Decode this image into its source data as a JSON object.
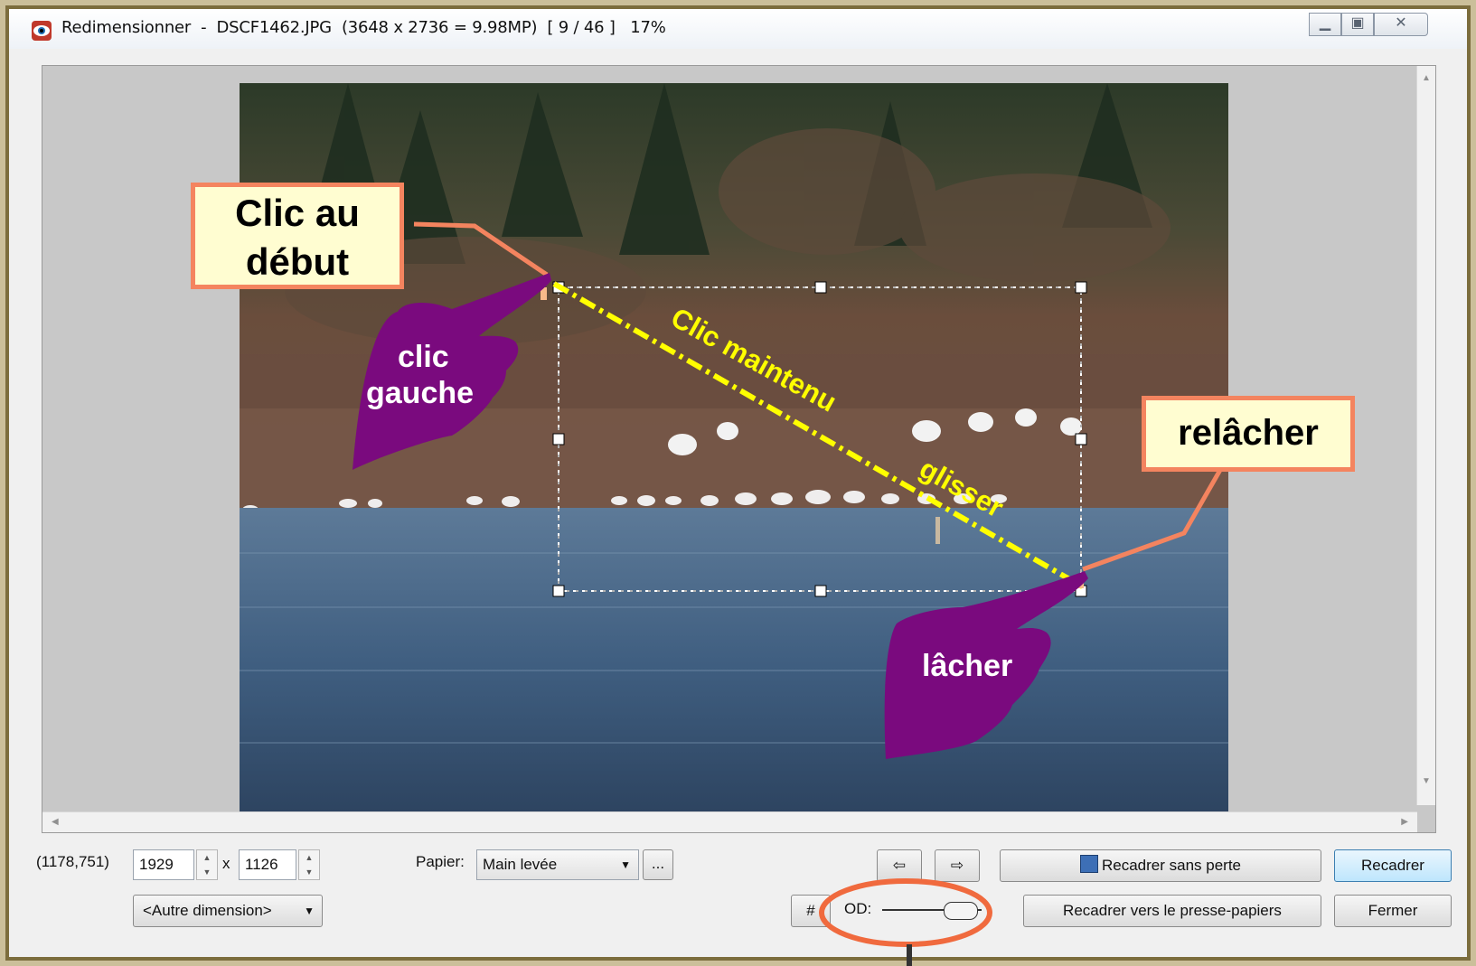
{
  "window": {
    "title": "Redimensionner  -  DSCF1462.JPG  (3648 x 2736 = 9.98MP)  [ 9 / 46 ]   17%",
    "controls": [
      "minimize-icon",
      "maximize-icon",
      "close-icon"
    ]
  },
  "annotations": {
    "start_callout": "Clic au début",
    "start_line1": "Clic au",
    "start_line2": "début",
    "left_hand_line1": "clic",
    "left_hand_line2": "gauche",
    "drag_text1": "Clic maintenu",
    "drag_text2": "glisser",
    "release_callout": "relâcher",
    "right_hand": "lâcher",
    "colors": {
      "callout_border": "#f4845f",
      "callout_fill": "#fffdd1",
      "hand": "#7a0a7e",
      "drag_line": "#ffff00",
      "od_circle": "#f06a3e"
    }
  },
  "status": {
    "cursor_pos": "(1178,751)"
  },
  "size": {
    "width": "1929",
    "times": "x",
    "height": "1126",
    "preset": "<Autre dimension>"
  },
  "paper": {
    "label": "Papier:",
    "value": "Main levée",
    "more": "..."
  },
  "nav": {
    "prev_icon": "arrow-left-icon",
    "next_icon": "arrow-right-icon"
  },
  "grid": {
    "label": "#"
  },
  "od": {
    "label": "OD:"
  },
  "buttons": {
    "lossless": "Recadrer sans perte",
    "crop": "Recadrer",
    "crop_clipboard": "Recadrer vers le presse-papiers",
    "close": "Fermer"
  }
}
